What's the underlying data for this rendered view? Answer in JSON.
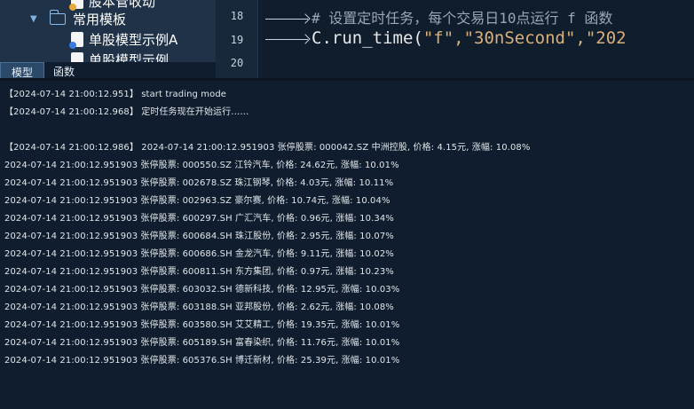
{
  "project_tree": {
    "items": [
      {
        "label": "股本管收动",
        "type": "file"
      },
      {
        "label": "常用模板",
        "type": "folder"
      },
      {
        "label": "单股模型示例A",
        "type": "file"
      },
      {
        "label": "单股模型示例",
        "type": "file"
      }
    ]
  },
  "editor": {
    "lines": [
      {
        "number": "18",
        "text": "# 设置定时任务，每个交易日10点运行 f 函数"
      },
      {
        "number": "19",
        "prefix": "C.run_time(",
        "args": "\"f\",\"30nSecond\",\"202"
      },
      {
        "number": "20",
        "text": ""
      }
    ]
  },
  "tabs": [
    {
      "label": "模型",
      "active": true
    },
    {
      "label": "函数",
      "active": false
    }
  ],
  "console": {
    "lines": [
      "【2024-07-14 21:00:12.951】  start trading mode",
      "【2024-07-14 21:00:12.968】  定时任务现在开始运行……",
      "",
      "【2024-07-14 21:00:12.986】  2024-07-14 21:00:12.951903 张停股票: 000042.SZ 中洲控股, 价格: 4.15元, 涨幅: 10.08%",
      "2024-07-14 21:00:12.951903 张停股票: 000550.SZ 江铃汽车, 价格: 24.62元, 涨幅: 10.01%",
      "2024-07-14 21:00:12.951903 张停股票: 002678.SZ 珠江钢琴, 价格: 4.03元, 涨幅: 10.11%",
      "2024-07-14 21:00:12.951903 张停股票: 002963.SZ 豪尔赛, 价格: 10.74元, 涨幅: 10.04%",
      "2024-07-14 21:00:12.951903 张停股票: 600297.SH 广汇汽车, 价格: 0.96元, 涨幅: 10.34%",
      "2024-07-14 21:00:12.951903 张停股票: 600684.SH 珠江股份, 价格: 2.95元, 涨幅: 10.07%",
      "2024-07-14 21:00:12.951903 张停股票: 600686.SH 金龙汽车, 价格: 9.11元, 涨幅: 10.02%",
      "2024-07-14 21:00:12.951903 张停股票: 600811.SH 东方集团, 价格: 0.97元, 涨幅: 10.23%",
      "2024-07-14 21:00:12.951903 张停股票: 603032.SH 德新科技, 价格: 12.95元, 涨幅: 10.03%",
      "2024-07-14 21:00:12.951903 张停股票: 603188.SH 亚邦股份, 价格: 2.62元, 涨幅: 10.08%",
      "2024-07-14 21:00:12.951903 张停股票: 603580.SH 艾艾精工, 价格: 19.35元, 涨幅: 10.01%",
      "2024-07-14 21:00:12.951903 张停股票: 605189.SH 富春染织, 价格: 11.76元, 涨幅: 10.01%",
      "2024-07-14 21:00:12.951903 张停股票: 605376.SH 博迁新材, 价格: 25.39元, 涨幅: 10.01%"
    ]
  }
}
